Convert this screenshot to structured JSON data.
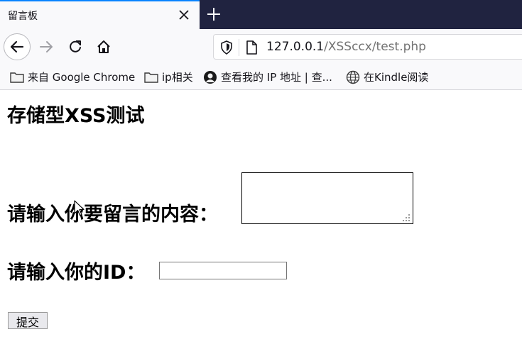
{
  "tab": {
    "title": "留言板"
  },
  "navbar": {
    "url_host": "127.0.0.1",
    "url_path": "/XSSccx/test.php"
  },
  "bookmarks": [
    {
      "label": "来自 Google Chrome",
      "icon": "folder-icon"
    },
    {
      "label": "ip相关",
      "icon": "folder-icon"
    },
    {
      "label": "查看我的 IP 地址 | 查...",
      "icon": "avatar-icon"
    },
    {
      "label": "在Kindle阅读",
      "icon": "globe-icon"
    }
  ],
  "page": {
    "title": "存储型XSS测试",
    "message_label": "请输入你要留言的内容：",
    "message_value": "",
    "id_label": "请输入你的ID：",
    "id_value": "",
    "submit_label": "提交"
  }
}
